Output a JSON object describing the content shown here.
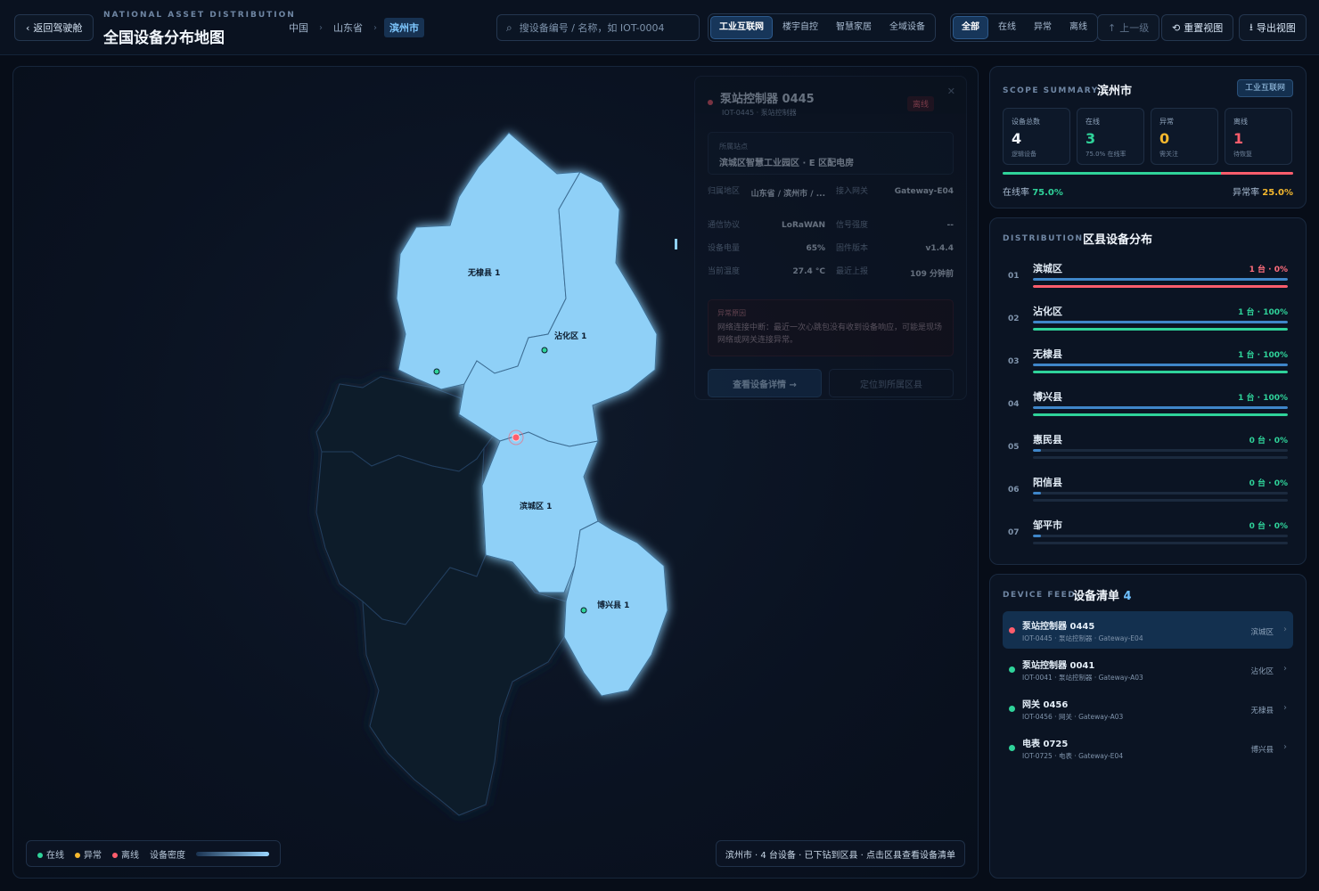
{
  "header": {
    "back_label": "返回驾驶舱",
    "eyebrow": "NATIONAL ASSET DISTRIBUTION",
    "title": "全国设备分布地图",
    "breadcrumb": [
      "中国",
      "山东省",
      "滨州市"
    ],
    "search_placeholder": "搜设备编号 / 名称，如 IOT-0004",
    "scene_tabs": [
      "工业互联网",
      "楼宇自控",
      "智慧家居",
      "全域设备"
    ],
    "status_tabs": [
      "全部",
      "在线",
      "异常",
      "离线"
    ],
    "up_label": "上一级",
    "reset_label": "重置视图",
    "export_label": "导出视图"
  },
  "map": {
    "regions": [
      {
        "name": "无棣县",
        "count": "1",
        "label": "无棣县 1"
      },
      {
        "name": "沾化区",
        "count": "1",
        "label": "沾化区 1"
      },
      {
        "name": "滨城区",
        "count": "1",
        "label": "滨城区 1"
      },
      {
        "name": "博兴县",
        "count": "1",
        "label": "博兴县 1"
      }
    ],
    "legend": {
      "online": "在线",
      "warning": "异常",
      "offline": "离线",
      "density": "设备密度"
    },
    "status_note": "滨州市 · 4 台设备 · 已下钻到区县 · 点击区县查看设备清单",
    "colors": {
      "region_fill": "#8fd0f7",
      "online": "#2fd39a",
      "warning": "#f5b82e",
      "offline": "#ff5d6c"
    }
  },
  "popup": {
    "title": "泵站控制器 0445",
    "subtitle": "IOT-0445 · 泵站控制器",
    "badge": "离线",
    "site_label": "所属站点",
    "site_value": "滨城区智慧工业园区 · E 区配电房",
    "fields": [
      {
        "k": "归属地区",
        "v": "山东省 / 滨州市 / ..."
      },
      {
        "k": "接入网关",
        "v": "Gateway-E04"
      },
      {
        "k": "通信协议",
        "v": "LoRaWAN"
      },
      {
        "k": "信号强度",
        "v": "--"
      },
      {
        "k": "设备电量",
        "v": "65%"
      },
      {
        "k": "固件版本",
        "v": "v1.4.4"
      },
      {
        "k": "当前温度",
        "v": "27.4 °C"
      },
      {
        "k": "最近上报",
        "v": "109 分钟前"
      }
    ],
    "alert_label": "异常原因",
    "alert_text": "网络连接中断：最近一次心跳包没有收到设备响应，可能是现场网络或网关连接异常。",
    "detail_button": "查看设备详情 →",
    "locate_button": "定位到所属区县"
  },
  "scope": {
    "eyebrow": "SCOPE SUMMARY",
    "title": "滨州市",
    "tag": "工业互联网",
    "stats": [
      {
        "label": "设备总数",
        "value": "4",
        "sub": "逻辑设备",
        "color": "#f1f6fc"
      },
      {
        "label": "在线",
        "value": "3",
        "sub": "75.0% 在线率",
        "color": "#2fd39a"
      },
      {
        "label": "异常",
        "value": "0",
        "sub": "需关注",
        "color": "#f5b82e"
      },
      {
        "label": "离线",
        "value": "1",
        "sub": "待恢复",
        "color": "#ff5d6c"
      }
    ],
    "online_rate_label": "在线率",
    "online_rate": "75.0%",
    "abnormal_rate_label": "异常率",
    "abnormal_rate": "25.0%",
    "online_fraction": 0.75
  },
  "distribution": {
    "eyebrow": "DISTRIBUTION",
    "title": "区县设备分布",
    "rows": [
      {
        "idx": "01",
        "name": "滨城区",
        "count": "1 台 · 0%",
        "share": 1.0,
        "health": 1.0,
        "health_color": "#ff5d6c",
        "count_color": "#ff6d7c"
      },
      {
        "idx": "02",
        "name": "沾化区",
        "count": "1 台 · 100%",
        "share": 1.0,
        "health": 1.0,
        "health_color": "#2fd39a",
        "count_color": "#2fd39a"
      },
      {
        "idx": "03",
        "name": "无棣县",
        "count": "1 台 · 100%",
        "share": 1.0,
        "health": 1.0,
        "health_color": "#2fd39a",
        "count_color": "#2fd39a"
      },
      {
        "idx": "04",
        "name": "博兴县",
        "count": "1 台 · 100%",
        "share": 1.0,
        "health": 1.0,
        "health_color": "#2fd39a",
        "count_color": "#2fd39a"
      },
      {
        "idx": "05",
        "name": "惠民县",
        "count": "0 台 · 0%",
        "share": 0.03,
        "health": 0,
        "health_color": "#2fd39a",
        "count_color": "#2fd39a"
      },
      {
        "idx": "06",
        "name": "阳信县",
        "count": "0 台 · 0%",
        "share": 0.03,
        "health": 0,
        "health_color": "#2fd39a",
        "count_color": "#2fd39a"
      },
      {
        "idx": "07",
        "name": "邹平市",
        "count": "0 台 · 0%",
        "share": 0.03,
        "health": 0,
        "health_color": "#2fd39a",
        "count_color": "#2fd39a"
      }
    ]
  },
  "feed": {
    "eyebrow": "DEVICE FEED",
    "title": "设备清单",
    "count": "4",
    "items": [
      {
        "name": "泵站控制器 0445",
        "sub": "IOT-0445 · 泵站控制器 · Gateway-E04",
        "region": "滨城区",
        "status_color": "#ff5d6c"
      },
      {
        "name": "泵站控制器 0041",
        "sub": "IOT-0041 · 泵站控制器 · Gateway-A03",
        "region": "沾化区",
        "status_color": "#2fd39a"
      },
      {
        "name": "网关 0456",
        "sub": "IOT-0456 · 网关 · Gateway-A03",
        "region": "无棣县",
        "status_color": "#2fd39a"
      },
      {
        "name": "电表 0725",
        "sub": "IOT-0725 · 电表 · Gateway-E04",
        "region": "博兴县",
        "status_color": "#2fd39a"
      }
    ]
  }
}
